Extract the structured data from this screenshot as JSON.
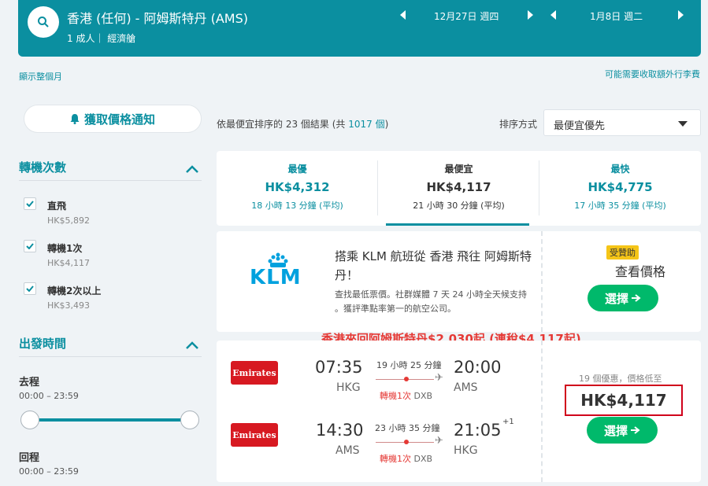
{
  "header": {
    "route": "香港 (任何) - 阿姆斯特丹 (AMS)",
    "pax": "1 成人｜ 經濟艙",
    "depart_date": "12月27日 週四",
    "return_date": "1月8日 週二"
  },
  "links": {
    "show_month": "顯示整個月",
    "extra_fee": "可能需要收取額外行李費"
  },
  "alert_button": "獲取價格通知",
  "filters": {
    "stops_title": "轉機次數",
    "stops": [
      {
        "label": "直飛",
        "price": "HK$5,892"
      },
      {
        "label": "轉機1次",
        "price": "HK$4,117"
      },
      {
        "label": "轉機2次以上",
        "price": "HK$3,493"
      }
    ],
    "time_title": "出發時間",
    "outbound_label": "去程",
    "outbound_range": "00:00 – 23:59",
    "return_label": "回程",
    "return_range": "00:00 – 23:59"
  },
  "results": {
    "prefix": "依最便宜排序的 23 個結果 (共 ",
    "total": "1017 個",
    "suffix": ")"
  },
  "sort": {
    "label": "排序方式",
    "selected": "最便宜優先"
  },
  "tabs": [
    {
      "title": "最優",
      "price": "HK$4,312",
      "duration": "18 小時 13 分鐘 (平均)"
    },
    {
      "title": "最便宜",
      "price": "HK$4,117",
      "duration": "21 小時 30 分鐘 (平均)"
    },
    {
      "title": "最快",
      "price": "HK$4,775",
      "duration": "17 小時 35 分鐘 (平均)"
    }
  ],
  "ad": {
    "logo_text": "KLM",
    "title": "搭乘 KLM 航班從 香港 飛往 阿姆斯特丹！",
    "desc": "查找最低票價。社群媒體 7 天 24 小時全天候支持 。獲評準點率第一的航空公司。",
    "sponsored": "受贊助",
    "view_price": "查看價格",
    "select": "選擇"
  },
  "promo": "香港來回阿姆斯特丹$2,030起 (連稅$4,117起)",
  "flight": {
    "airline": "Emirates",
    "legs": [
      {
        "dep_time": "07:35",
        "dep_code": "HKG",
        "duration": "19 小時 25 分鐘",
        "stops": "轉機1次",
        "via": "DXB",
        "arr_time": "20:00",
        "arr_code": "AMS",
        "plus": ""
      },
      {
        "dep_time": "14:30",
        "dep_code": "AMS",
        "duration": "23 小時 35 分鐘",
        "stops": "轉機1次",
        "via": "DXB",
        "arr_time": "21:05",
        "arr_code": "HKG",
        "plus": "+1"
      }
    ],
    "deals": "19 個優惠，價格低至",
    "price": "HK$4,117",
    "select": "選擇"
  },
  "colors": {
    "accent": "#0b8fa0",
    "select_green": "#00b96b",
    "promo_red": "#e53935"
  }
}
